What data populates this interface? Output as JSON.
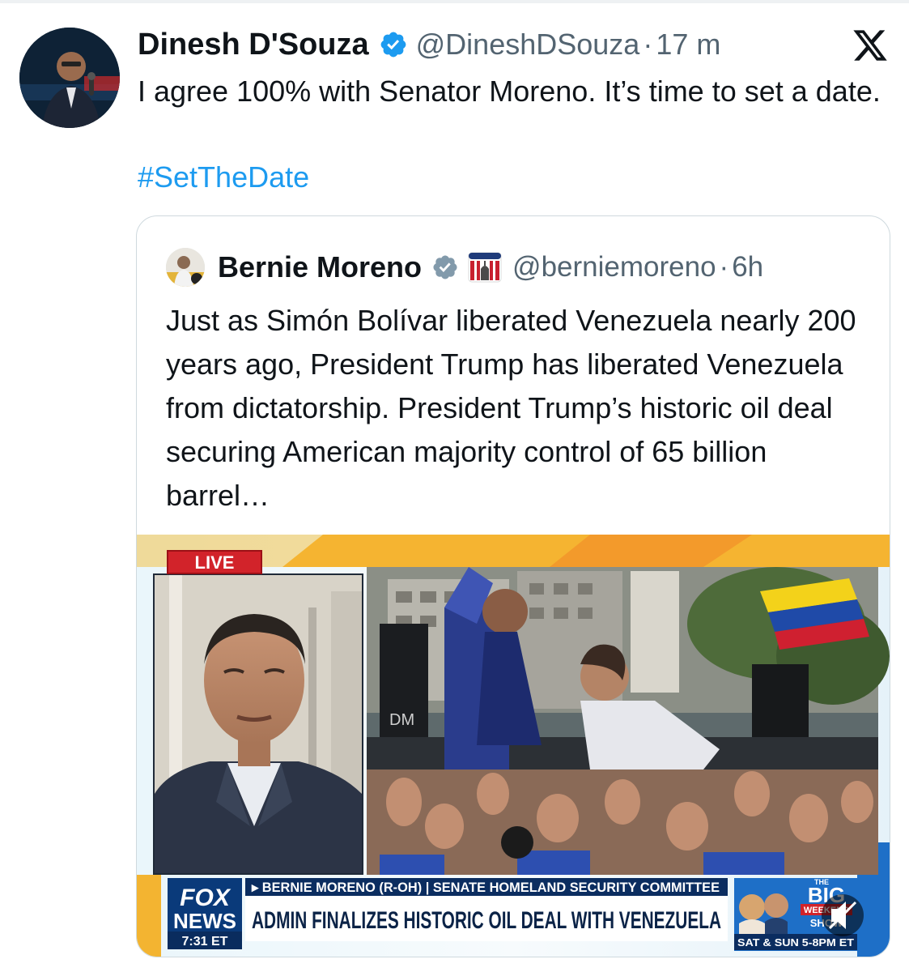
{
  "tweet": {
    "author_name": "Dinesh D'Souza",
    "handle": "@DineshDSouza",
    "separator": "·",
    "time": "17 m",
    "text": "I agree 100% with Senator Moreno. It’s time to set a date.",
    "hashtag": "#SetTheDate"
  },
  "quoted_tweet": {
    "author_name": "Bernie Moreno",
    "handle": "@berniemoreno",
    "separator": "·",
    "time": "6h",
    "text": "Just as Simón Bolívar liberated Venezuela nearly 200 years ago, President Trump has liberated Venezuela from dictatorship. President Trump’s historic oil deal securing American majority control of 65 billion barrel…"
  },
  "media": {
    "live_badge": "LIVE",
    "network_line1": "FOX",
    "network_line2": "NEWS",
    "clock": "7:31 ET",
    "lower_third_top": "▸ BERNIE MORENO (R-OH) | SENATE HOMELAND SECURITY COMMITTEE",
    "lower_third_main": "ADMIN FINALIZES HISTORIC OIL DEAL WITH VENEZUELA",
    "promo_the": "THE",
    "promo_big": "BIG",
    "promo_weekend": "WEEKEND",
    "promo_show": "SHOW",
    "promo_schedule": "SAT & SUN 5-8PM ET",
    "billboard_text": "DM"
  },
  "colors": {
    "link": "#1d9bf0",
    "secondary_text": "#536471",
    "verified_blue": "#1d9bf0",
    "verified_gray": "#829aab",
    "fox_blue": "#0a3a7a",
    "live_red": "#d2232a"
  },
  "icons": {
    "verified": "verified-badge-icon",
    "x_logo": "x-logo-icon",
    "flag": "us-capitol-flag-icon",
    "mute": "muted-speaker-icon"
  }
}
